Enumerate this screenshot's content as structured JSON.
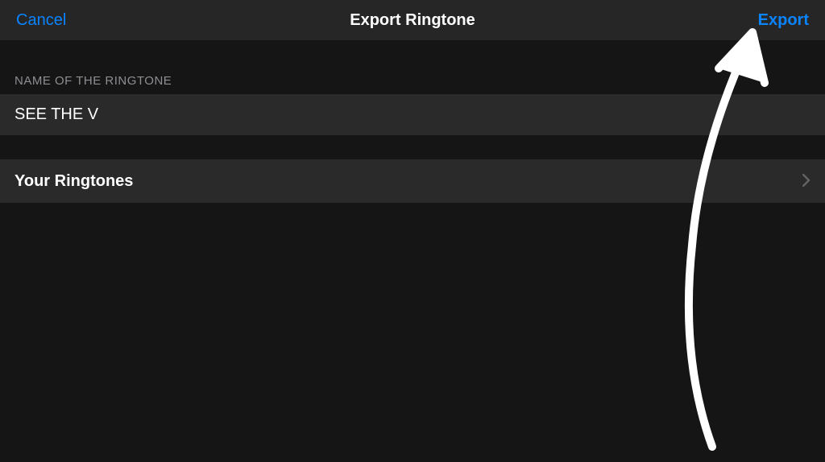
{
  "navbar": {
    "cancel": "Cancel",
    "title": "Export Ringtone",
    "export": "Export"
  },
  "form": {
    "section_header": "NAME OF THE RINGTONE",
    "ringtone_name": "SEE THE V"
  },
  "rows": {
    "your_ringtones": "Your Ringtones"
  },
  "colors": {
    "background": "#151515",
    "row_bg": "#2a2a2a",
    "nav_bg": "#262626",
    "accent": "#0a84ff",
    "text_primary": "#ffffff",
    "text_secondary": "#8e8e93"
  }
}
